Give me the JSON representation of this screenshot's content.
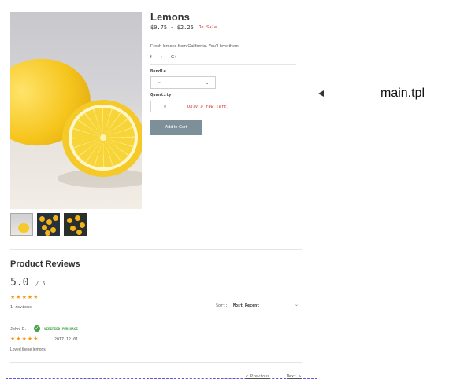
{
  "annotation": {
    "label": "main.tpl"
  },
  "product": {
    "title": "Lemons",
    "price": "$0.75 - $2.25",
    "sale_badge": "On Sale",
    "description": "Fresh lemons from California. You'll love them!",
    "social": {
      "facebook": "f",
      "twitter": "t",
      "google": "G+"
    },
    "bundle_label": "Bundle",
    "bundle_value": "---",
    "quantity_label": "Quantity",
    "quantity_value": "0",
    "only_few_left": "Only a few left!",
    "add_to_cart": "Add to Cart"
  },
  "reviews": {
    "title": "Product Reviews",
    "score": "5.0",
    "score_out_of": "/ 5",
    "rating_stars": 5,
    "count": "1 reviews",
    "sort_label": "Sort:",
    "sort_value": "Most Recent",
    "items": [
      {
        "author": "John D.",
        "verified": "VERIFIED PURCHASE",
        "stars": 5,
        "date": "2017-12-01",
        "text": "Loved these lemons!"
      }
    ],
    "pagination": {
      "previous": "< Previous",
      "next": "Next >"
    }
  },
  "colors": {
    "accent": "#7d8f99",
    "sale": "#d32f2f",
    "star": "#f39c12",
    "verified": "#43a047",
    "frame": "#5b57d6"
  }
}
